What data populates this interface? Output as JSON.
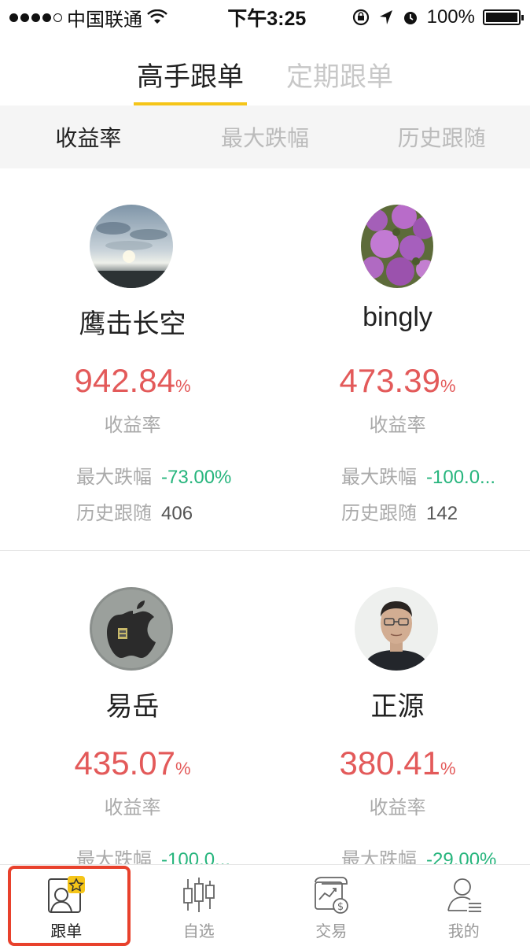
{
  "status_bar": {
    "carrier": "中国联通",
    "time": "下午3:25",
    "battery": "100%"
  },
  "top_tabs": [
    {
      "label": "高手跟单",
      "active": true
    },
    {
      "label": "定期跟单",
      "active": false
    }
  ],
  "sort_tabs": [
    {
      "label": "收益率",
      "active": true
    },
    {
      "label": "最大跌幅",
      "active": false
    },
    {
      "label": "历史跟随",
      "active": false
    }
  ],
  "traders": [
    {
      "name": "鹰击长空",
      "rate": "942.84",
      "rate_unit": "%",
      "rate_label": "收益率",
      "drawdown_label": "最大跌幅",
      "drawdown": "-73.00%",
      "followers_label": "历史跟随",
      "followers": "406",
      "avatar": "sky-landscape-photo"
    },
    {
      "name": "bingly",
      "rate": "473.39",
      "rate_unit": "%",
      "rate_label": "收益率",
      "drawdown_label": "最大跌幅",
      "drawdown": "-100.0...",
      "followers_label": "历史跟随",
      "followers": "142",
      "avatar": "purple-flowers-photo"
    },
    {
      "name": "易岳",
      "rate": "435.07",
      "rate_unit": "%",
      "rate_label": "收益率",
      "drawdown_label": "最大跌幅",
      "drawdown": "-100.0...",
      "avatar": "apple-logo-photo"
    },
    {
      "name": "正源",
      "rate": "380.41",
      "rate_unit": "%",
      "rate_label": "收益率",
      "drawdown_label": "最大跌幅",
      "drawdown": "-29.00%",
      "avatar": "man-portrait-photo"
    }
  ],
  "tab_bar": [
    {
      "label": "跟单",
      "icon": "follow-star-user-icon",
      "active": true
    },
    {
      "label": "自选",
      "icon": "candlestick-icon",
      "active": false
    },
    {
      "label": "交易",
      "icon": "trade-chart-icon",
      "active": false
    },
    {
      "label": "我的",
      "icon": "profile-icon",
      "active": false
    }
  ],
  "colors": {
    "accent_yellow": "#f5c518",
    "rate_red": "#e35a5a",
    "drawdown_green": "#27b57d",
    "highlight_red": "#e8412c"
  }
}
